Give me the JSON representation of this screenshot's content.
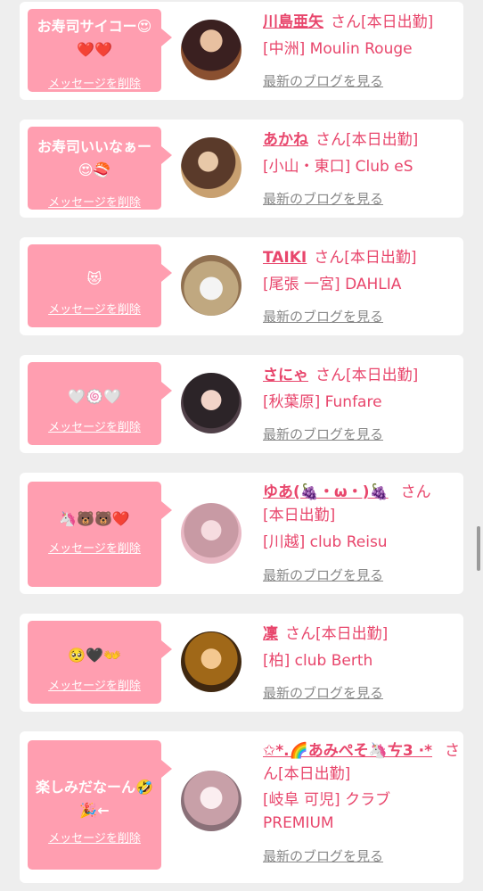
{
  "delete_label": "メッセージを削除",
  "blog_label": "最新のブログを見る",
  "colors": {
    "accent": "#e8466c",
    "bubble": "#ff9eb0",
    "link_gray": "#888888",
    "card_bg": "#ffffff",
    "page_bg": "#eeeeee"
  },
  "messages": [
    {
      "msg_lines": [
        "お寿司サイコー😍",
        "❤️❤️"
      ],
      "name": "川島亜矢",
      "status": "さん[本日出勤]",
      "shop": "[中洲] Moulin Rouge",
      "avatar_colors": [
        "#2a1a1a",
        "#c8a080"
      ]
    },
    {
      "msg_lines": [
        "お寿司いいなぁー",
        "😍🍣"
      ],
      "name": "あかね",
      "status": "さん[本日出勤]",
      "shop": "[小山・東口] Club eS",
      "avatar_colors": [
        "#6a4a3a",
        "#d8b890"
      ]
    },
    {
      "msg_lines": [
        "😻"
      ],
      "name": "TAIKI",
      "status": "さん[本日出勤]",
      "shop": "[尾張 一宮] DAHLIA",
      "avatar_colors": [
        "#a08860",
        "#f0f0f0"
      ]
    },
    {
      "msg_lines": [
        "🤍🍥🤍"
      ],
      "name": "さにゃ",
      "status": "さん[本日出勤]",
      "shop": "[秋葉原] Funfare",
      "avatar_colors": [
        "#302830",
        "#f0d0c8"
      ]
    },
    {
      "msg_lines": [
        "🦄🐻🐻❤️"
      ],
      "name": "ゆあ(🍇・ω・)🍇",
      "status_line1": "さん",
      "status": "[本日出勤]",
      "shop": "[川越] club Reisu",
      "avatar_colors": [
        "#c89098",
        "#f4d8e0"
      ]
    },
    {
      "msg_lines": [
        "🥺🖤👐"
      ],
      "name": "凜",
      "status": "さん[本日出勤]",
      "shop": "[柏] club Berth",
      "avatar_colors": [
        "#805010",
        "#f0c060"
      ]
    },
    {
      "msg_lines": [
        "楽しみだなーん🤣",
        "🎉←"
      ],
      "name": "✩*.🌈あみぺそ🦄ㄘ3 ·*",
      "status_line1": "さ",
      "status": "ん[本日出勤]",
      "shop_lines": [
        "[岐阜 可児] クラブ",
        "PREMIUM"
      ],
      "avatar_colors": [
        "#b09098",
        "#f8e8ec"
      ]
    }
  ]
}
